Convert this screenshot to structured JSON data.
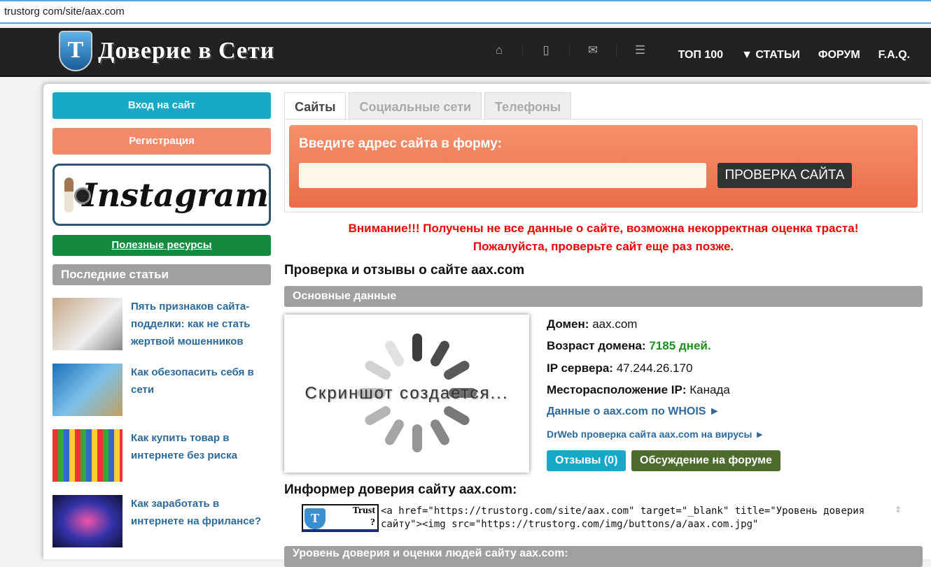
{
  "url": "trustorg com/site/aax.com",
  "logo": {
    "mark": "T",
    "text": "Доверие в Сети"
  },
  "nav_icons": [
    "home-icon",
    "mobile-icon",
    "mail-icon",
    "list-icon"
  ],
  "nav": [
    "ТОП 100",
    "▼ СТАТЬИ",
    "ФОРУМ",
    "F.A.Q."
  ],
  "sidebar": {
    "login": "Вход на сайт",
    "register": "Регистрация",
    "instagram": "Instagram",
    "resources": "Полезные ресурсы",
    "latest": "Последние статьи",
    "articles": [
      "Пять признаков сайта-подделки: как не стать жертвой мошенников",
      "Как обезопасить себя в сети",
      "Как купить товар в интернете без риска",
      "Как заработать в интернете на фрилансе?"
    ]
  },
  "tabs": [
    "Сайты",
    "Социальные сети",
    "Телефоны"
  ],
  "form": {
    "title": "Введите адрес сайта в форму:",
    "value": "",
    "button": "ПРОВЕРКА САЙТА"
  },
  "warning": [
    "Внимание!!! Получены не все данные о сайте, возможна некорректная оценка траста!",
    "Пожалуйста, проверьте сайт еще раз позже."
  ],
  "heading": "Проверка и отзывы о сайте aax.com",
  "basic": "Основные данные",
  "screenshot": "Скриншот создается...",
  "info": {
    "domain_label": "Домен:",
    "domain": "aax.com",
    "age_label": "Возраст домена:",
    "age": "7185 дней.",
    "ip_label": "IP сервера:",
    "ip": "47.244.26.170",
    "loc_label": "Месторасположение IP:",
    "loc": "Канада",
    "whois": "Данные о aax.com по WHOIS ►",
    "drweb": "DrWeb проверка сайта aax.com на вирусы ►",
    "reviews": "Отзывы (0)",
    "forum": "Обсуждение на форуме"
  },
  "informer": {
    "title": "Информер доверия сайту aax.com:",
    "badge_text": "Trust",
    "badge_q": "?",
    "code": "<a href=\"https://trustorg.com/site/aax.com\" target=\"_blank\" title=\"Уровень доверия сайту\"><img src=\"https://trustorg.com/img/buttons/a/aax.com.jpg\""
  },
  "bottom_section": "Уровень доверия и оценки людей сайту aax.com:"
}
